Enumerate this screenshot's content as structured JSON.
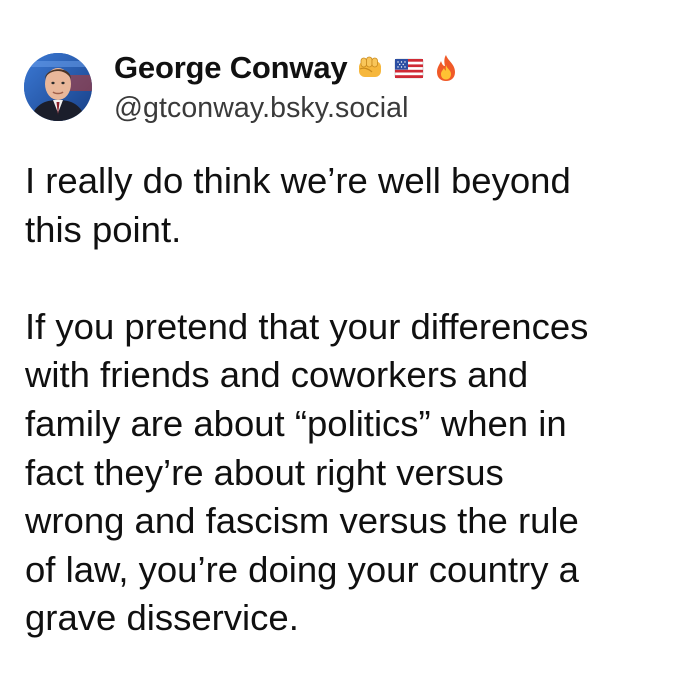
{
  "post": {
    "author": {
      "display_name": "George Conway",
      "handle": "@gtconway.bsky.social",
      "badges": [
        "fist-emoji",
        "us-flag-emoji",
        "fire-emoji"
      ],
      "avatar_icon": "profile-photo"
    },
    "paragraphs": [
      {
        "lines": [
          "I really do think we’re well beyond",
          "this point."
        ]
      },
      {
        "lines": [
          "If you pretend that your differences",
          "with friends and coworkers and",
          "family are about “politics” when in",
          "fact they’re about right versus",
          "wrong and fascism versus the rule",
          "of law, you’re doing your country a",
          "grave disservice."
        ]
      }
    ]
  },
  "colors": {
    "background": "#ffffff",
    "text": "#101010",
    "handle": "#3a3a3a"
  }
}
